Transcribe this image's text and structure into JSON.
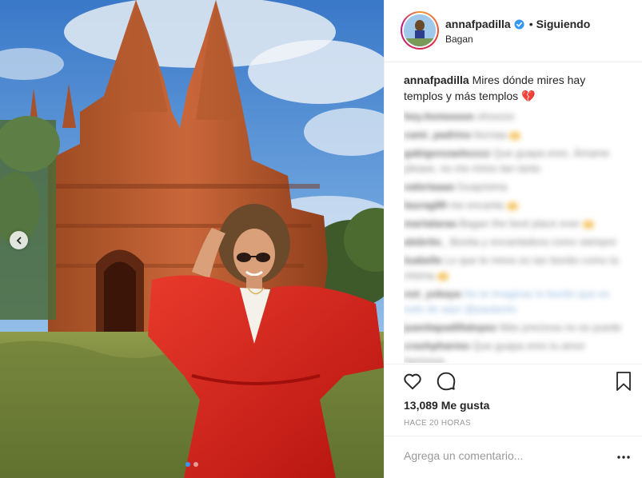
{
  "post": {
    "username": "annafpadilla",
    "separator": "•",
    "follow_status": "Siguiendo",
    "location": "Bagan",
    "caption": {
      "username": "annafpadilla",
      "text": "Mires dónde mires hay templos y más templos 💔"
    },
    "blurred_comments": [
      {
        "user": "hey.itsmeeeee",
        "text": "ohsssss"
      },
      {
        "user": "cami_padrino",
        "text": "liscnaa"
      },
      {
        "user": "gabigonzaelezzzz",
        "text": "Que guapa eres. Ámame please, no me mires tan tanto"
      },
      {
        "user": "valeriaaaa",
        "text": "Guapísima"
      },
      {
        "user": "laurag99",
        "text": "me encanta"
      },
      {
        "user": "martalaraa",
        "text": "Bagan the best place ever"
      },
      {
        "user": "alebrito_",
        "text": "Bonita y encantadora como siempre"
      },
      {
        "user": "Isabelle",
        "text": "Lo que te mires es tan bonito como tú misma"
      },
      {
        "user": "not_yokaya",
        "text": "No te imaginas lo bonito que es todo de aquí  @paulacito"
      },
      {
        "user": "juanitapadillalopez",
        "text": "Más preciosa no se puede"
      },
      {
        "user": "crashpharmo",
        "text": "Que guapa eres tu amor hermosa"
      }
    ],
    "likes_text": "13,089 Me gusta",
    "time_text": "Hace 20 horas",
    "comment_placeholder": "Agrega un comentario...",
    "carousel": {
      "total": 2,
      "active": 0
    }
  },
  "colors": {
    "accent": "#3897f0",
    "heart": "#ed4956",
    "text": "#262626",
    "muted": "#999999",
    "border": "#efefef",
    "dress": "#d3201c"
  },
  "icons": [
    "chevron-left-icon",
    "verified-badge-icon",
    "heart-icon",
    "comment-icon",
    "bookmark-icon",
    "more-options-icon"
  ]
}
